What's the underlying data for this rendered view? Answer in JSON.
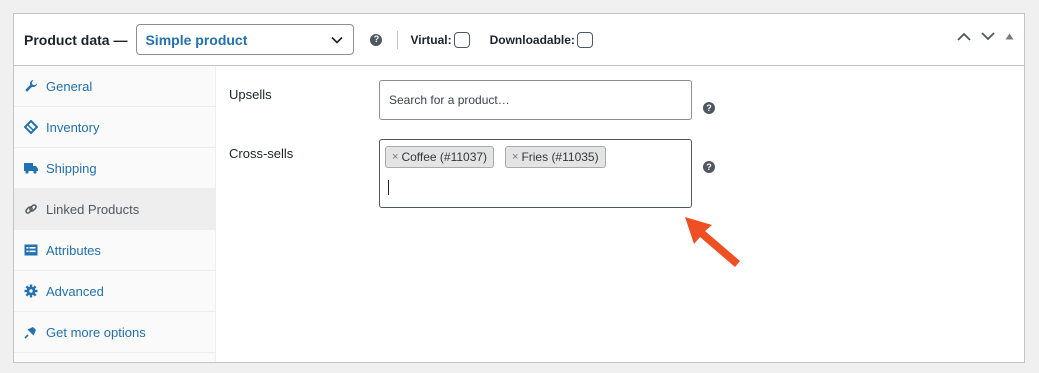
{
  "header": {
    "title": "Product data —",
    "product_type": "Simple product",
    "help": "?",
    "virtual_label": "Virtual:",
    "downloadable_label": "Downloadable:"
  },
  "sidebar": {
    "items": [
      {
        "label": "General",
        "icon": "wrench-icon",
        "active": false
      },
      {
        "label": "Inventory",
        "icon": "tag-icon",
        "active": false
      },
      {
        "label": "Shipping",
        "icon": "truck-icon",
        "active": false
      },
      {
        "label": "Linked Products",
        "icon": "link-icon",
        "active": true
      },
      {
        "label": "Attributes",
        "icon": "list-icon",
        "active": false
      },
      {
        "label": "Advanced",
        "icon": "gear-icon",
        "active": false
      },
      {
        "label": "Get more options",
        "icon": "plug-icon",
        "active": false
      }
    ]
  },
  "linked": {
    "upsells_label": "Upsells",
    "upsells_placeholder": "Search for a product…",
    "crosssells_label": "Cross-sells",
    "crosssells_chips": [
      "Coffee (#11037)",
      "Fries (#11035)"
    ],
    "chip_remove": "×"
  },
  "colors": {
    "accent": "#2271b1",
    "annotation_arrow": "#f04e23"
  }
}
